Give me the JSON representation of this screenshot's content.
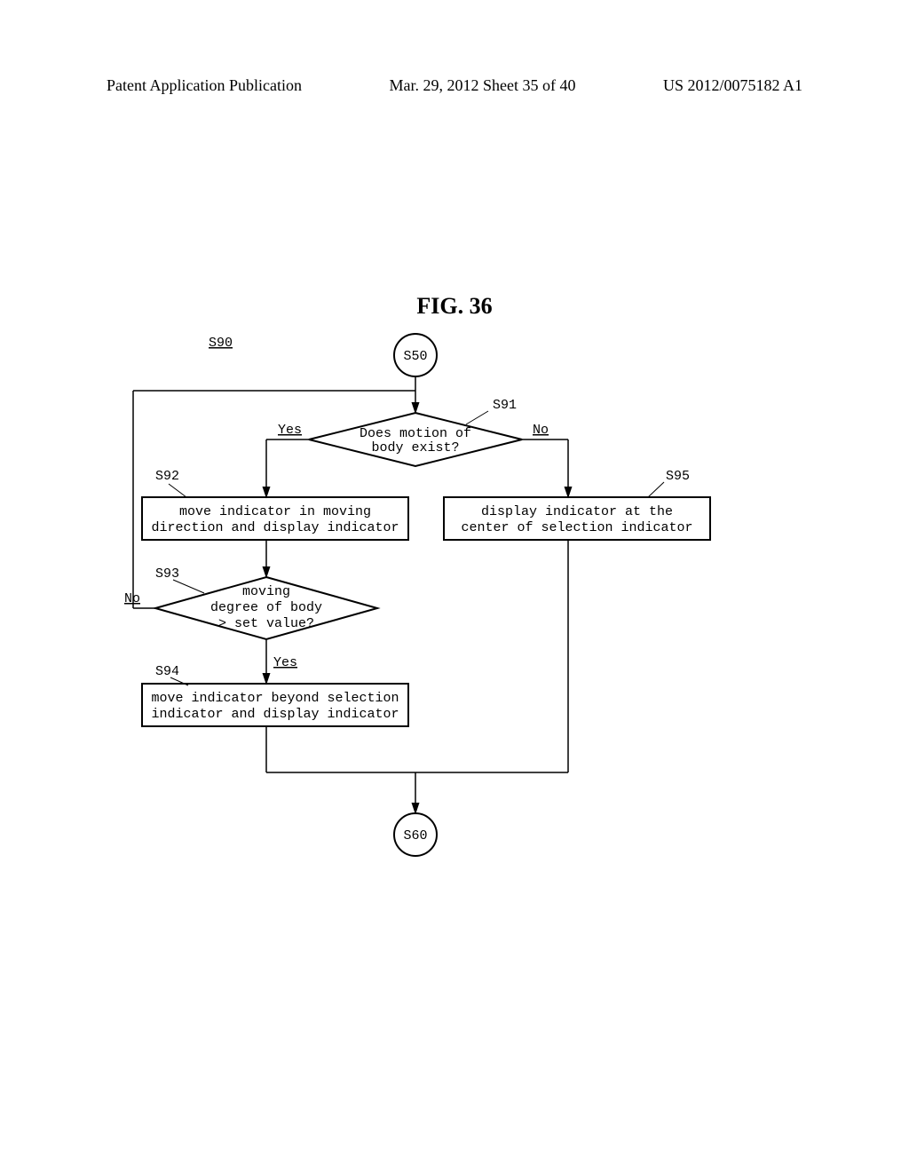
{
  "header": {
    "left": "Patent Application Publication",
    "mid": "Mar. 29, 2012  Sheet 35 of 40",
    "right": "US 2012/0075182 A1"
  },
  "figure": {
    "title": "FIG. 36",
    "section": "S90",
    "start": "S50",
    "end": "S60",
    "d1": {
      "id": "S91",
      "text1": "Does motion of",
      "text2": "body exist?",
      "yes": "Yes",
      "no": "No"
    },
    "p1": {
      "id": "S92",
      "text1": "move indicator in moving",
      "text2": "direction and display indicator"
    },
    "p2": {
      "id": "S95",
      "text1": "display indicator at the",
      "text2": "center of selection indicator"
    },
    "d2": {
      "id": "S93",
      "text1": "moving",
      "text2": "degree of body",
      "text3": "> set value?",
      "yes": "Yes",
      "no": "No"
    },
    "p3": {
      "id": "S94",
      "text1": "move indicator beyond selection",
      "text2": "indicator and display indicator"
    }
  },
  "chart_data": {
    "type": "flowchart",
    "title": "FIG. 36",
    "section_label": "S90",
    "nodes": [
      {
        "id": "S50",
        "type": "connector",
        "text": "S50"
      },
      {
        "id": "S91",
        "type": "decision",
        "text": "Does motion of body exist?"
      },
      {
        "id": "S92",
        "type": "process",
        "text": "move indicator in moving direction and display indicator"
      },
      {
        "id": "S95",
        "type": "process",
        "text": "display indicator at the center of selection indicator"
      },
      {
        "id": "S93",
        "type": "decision",
        "text": "moving degree of body > set value?"
      },
      {
        "id": "S94",
        "type": "process",
        "text": "move indicator beyond selection indicator and display indicator"
      },
      {
        "id": "S60",
        "type": "connector",
        "text": "S60"
      }
    ],
    "edges": [
      {
        "from": "S50",
        "to": "S91"
      },
      {
        "from": "S91",
        "to": "S92",
        "label": "Yes"
      },
      {
        "from": "S91",
        "to": "S95",
        "label": "No"
      },
      {
        "from": "S92",
        "to": "S93"
      },
      {
        "from": "S93",
        "to": "S94",
        "label": "Yes"
      },
      {
        "from": "S93",
        "to": "S91",
        "label": "No",
        "note": "loop back"
      },
      {
        "from": "S94",
        "to": "S60"
      },
      {
        "from": "S95",
        "to": "S60"
      }
    ]
  }
}
